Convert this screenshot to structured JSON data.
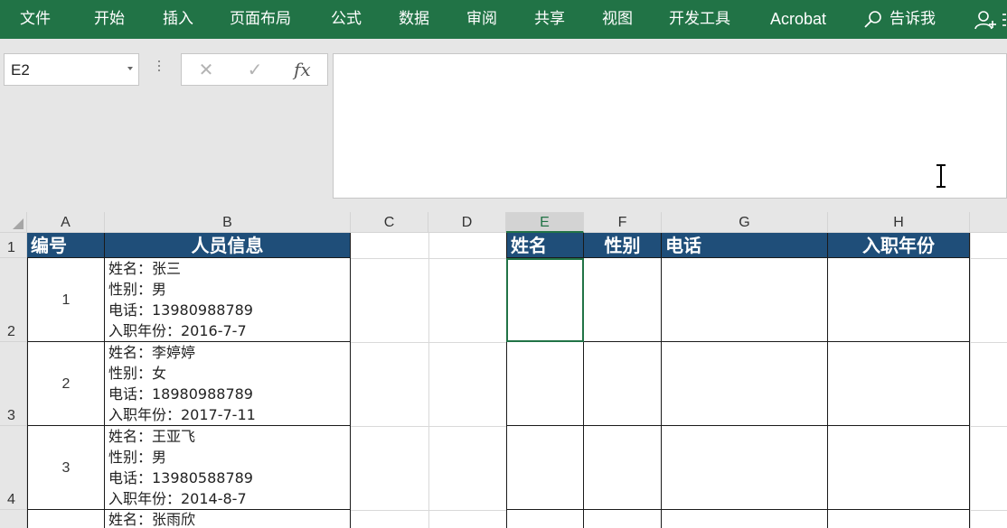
{
  "ribbon": {
    "tabs": [
      {
        "id": "file",
        "label": "文件"
      },
      {
        "id": "home",
        "label": "开始"
      },
      {
        "id": "insert",
        "label": "插入"
      },
      {
        "id": "page-layout",
        "label": "页面布局"
      },
      {
        "id": "formulas",
        "label": "公式"
      },
      {
        "id": "data",
        "label": "数据"
      },
      {
        "id": "review",
        "label": "审阅"
      },
      {
        "id": "share",
        "label": "共享"
      },
      {
        "id": "view",
        "label": "视图"
      },
      {
        "id": "developer",
        "label": "开发工具"
      },
      {
        "id": "acrobat",
        "label": "Acrobat"
      }
    ],
    "tell_me": "告诉我",
    "tell_me_icon": "search-icon",
    "user_icon": "user-icon",
    "accent_color": "#217346"
  },
  "formula_bar": {
    "name_box": "E2",
    "cancel_symbol": "✕",
    "enter_symbol": "✓",
    "fx_label": "fx",
    "formula": ""
  },
  "sheet": {
    "columns": [
      "A",
      "B",
      "C",
      "D",
      "E",
      "F",
      "G",
      "H"
    ],
    "active_column": "E",
    "rows": [
      "1",
      "2",
      "3",
      "4"
    ],
    "header_fill": "#1f4e79",
    "headers_left": {
      "a": "编号",
      "b": "人员信息"
    },
    "headers_right": {
      "e": "姓名",
      "f": "性别",
      "g": "电话",
      "h": "入职年份"
    },
    "records": [
      {
        "id": "1",
        "info": [
          "姓名：张三",
          "性别：男",
          "电话：13980988789",
          "入职年份：2016-7-7"
        ]
      },
      {
        "id": "2",
        "info": [
          "姓名：李婷婷",
          "性别：女",
          "电话：18980988789",
          "入职年份：2017-7-11"
        ]
      },
      {
        "id": "3",
        "info": [
          "姓名：王亚飞",
          "性别：男",
          "电话：13980588789",
          "入职年份：2014-8-7"
        ]
      },
      {
        "id": "",
        "info": [
          "姓名：张雨欣"
        ]
      }
    ]
  }
}
